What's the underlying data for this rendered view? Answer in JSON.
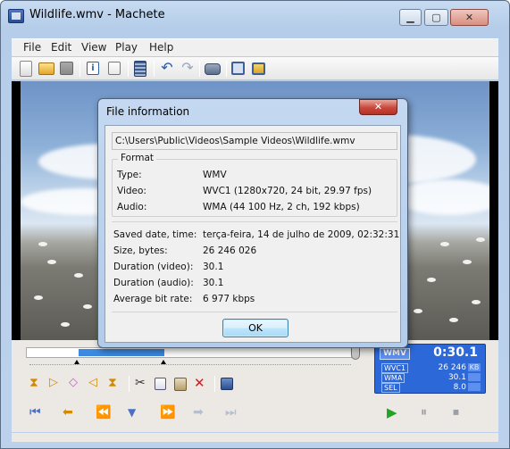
{
  "window": {
    "title": "Wildlife.wmv - Machete"
  },
  "menu": {
    "items": [
      "File",
      "Edit",
      "View",
      "Play",
      "Help"
    ]
  },
  "toolbar": {
    "icons": [
      "new-file-icon",
      "open-folder-icon",
      "save-icon",
      "info-icon",
      "edit-tags-icon",
      "film-strip-icon",
      "undo-icon",
      "redo-icon",
      "camera-icon",
      "frame-icon",
      "export-frame-icon"
    ]
  },
  "info_panel": {
    "format": "WMV",
    "time": "0:30.1",
    "rows": [
      {
        "label": "WVC1",
        "value": "26 246",
        "unit": "KB"
      },
      {
        "label": "WMA",
        "value": "30.1",
        "unit": ""
      },
      {
        "label": "SEL",
        "value": "8.0",
        "unit": ""
      }
    ]
  },
  "dialog": {
    "title": "File information",
    "close_symbol": "✕",
    "path": "C:\\Users\\Public\\Videos\\Sample Videos\\Wildlife.wmv",
    "format_group": {
      "label": "Format",
      "rows": [
        {
          "label": "Type:",
          "value": "WMV"
        },
        {
          "label": "Video:",
          "value": "WVC1  (1280x720, 24 bit, 29.97 fps)"
        },
        {
          "label": "Audio:",
          "value": "WMA  (44 100 Hz, 2 ch, 192 kbps)"
        }
      ]
    },
    "details": [
      {
        "label": "Saved date, time:",
        "value": "terça-feira, 14 de julho de 2009, 02:32:31"
      },
      {
        "label": "Size, bytes:",
        "value": "26 246 026"
      },
      {
        "label": "Duration (video):",
        "value": "30.1"
      },
      {
        "label": "Duration (audio):",
        "value": "30.1"
      },
      {
        "label": "Average bit rate:",
        "value": "6 977 kbps"
      }
    ],
    "ok_label": "OK"
  }
}
